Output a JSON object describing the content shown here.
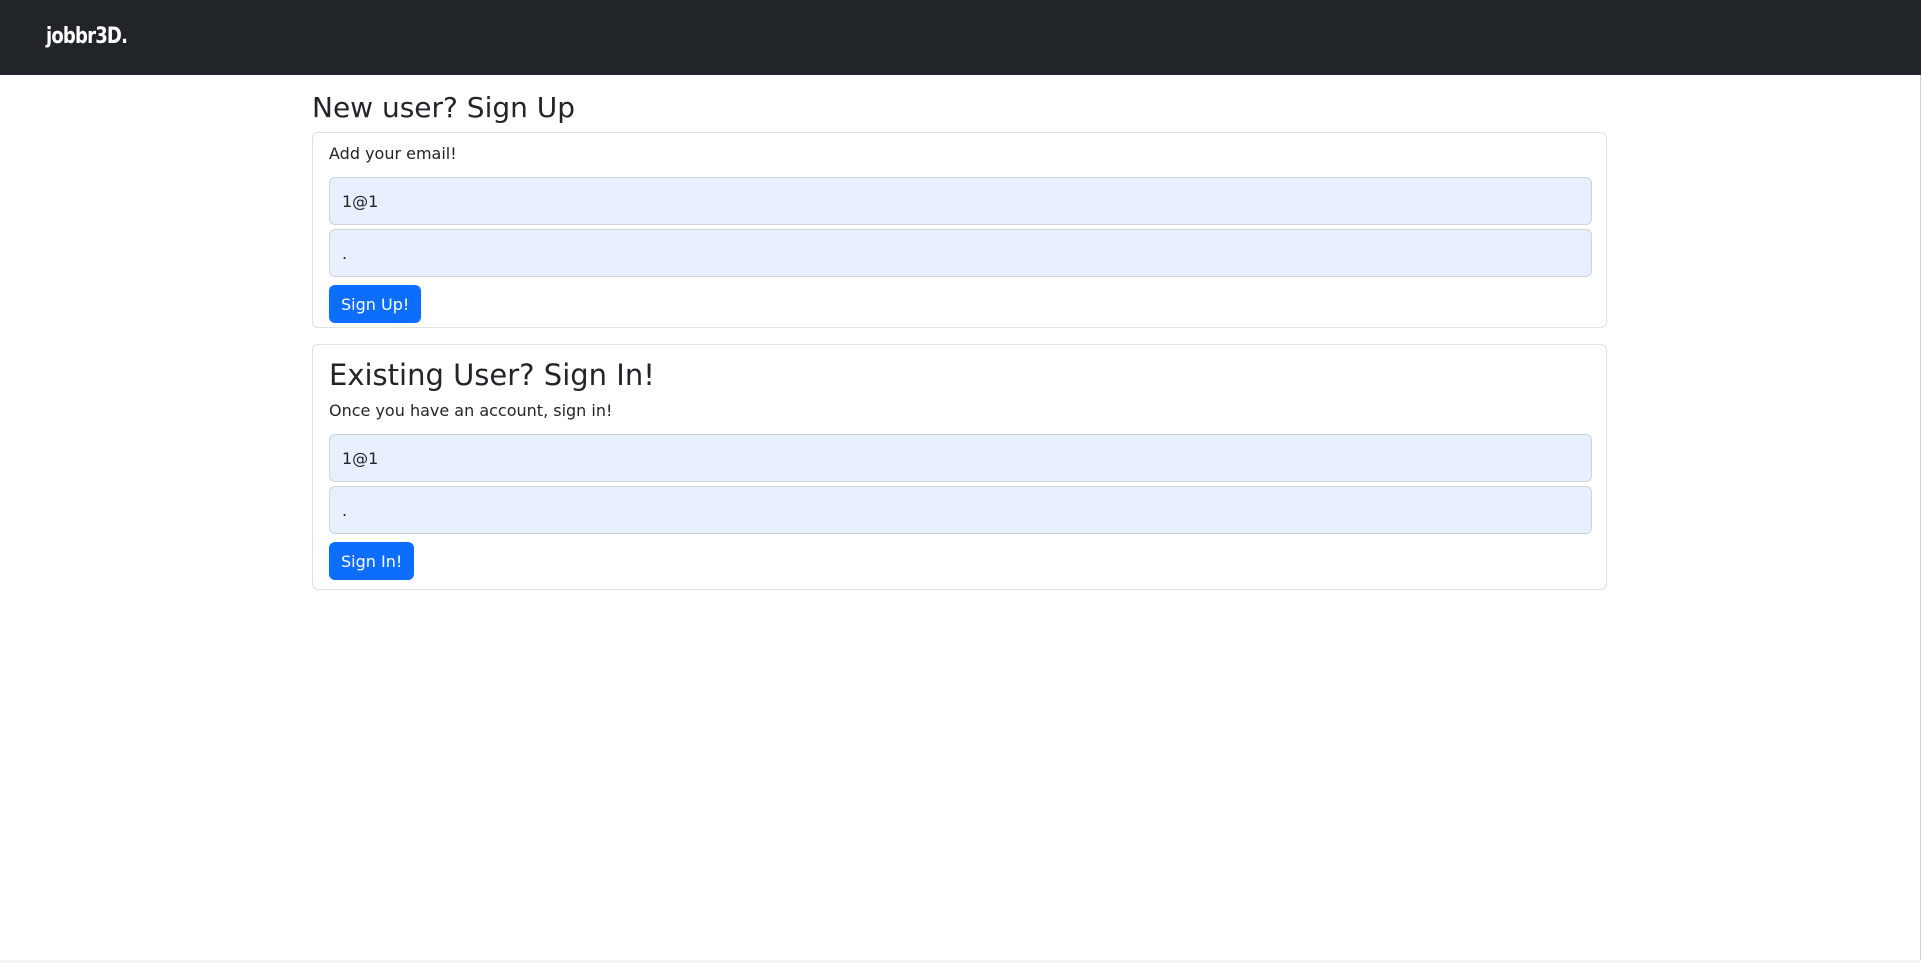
{
  "navbar": {
    "brand": "jobbr3D."
  },
  "signup": {
    "title": "New user? Sign Up",
    "prompt": "Add your email!",
    "email_value": "1@1",
    "password_value": ".",
    "button_label": "Sign Up!"
  },
  "signin": {
    "title": "Existing User? Sign In!",
    "prompt": "Once you have an account, sign in!",
    "email_value": "1@1",
    "password_value": ".",
    "button_label": "Sign In!"
  },
  "colors": {
    "navbar_bg": "#212529",
    "primary": "#0d6efd",
    "input_autofill_bg": "#e8f0fe"
  }
}
